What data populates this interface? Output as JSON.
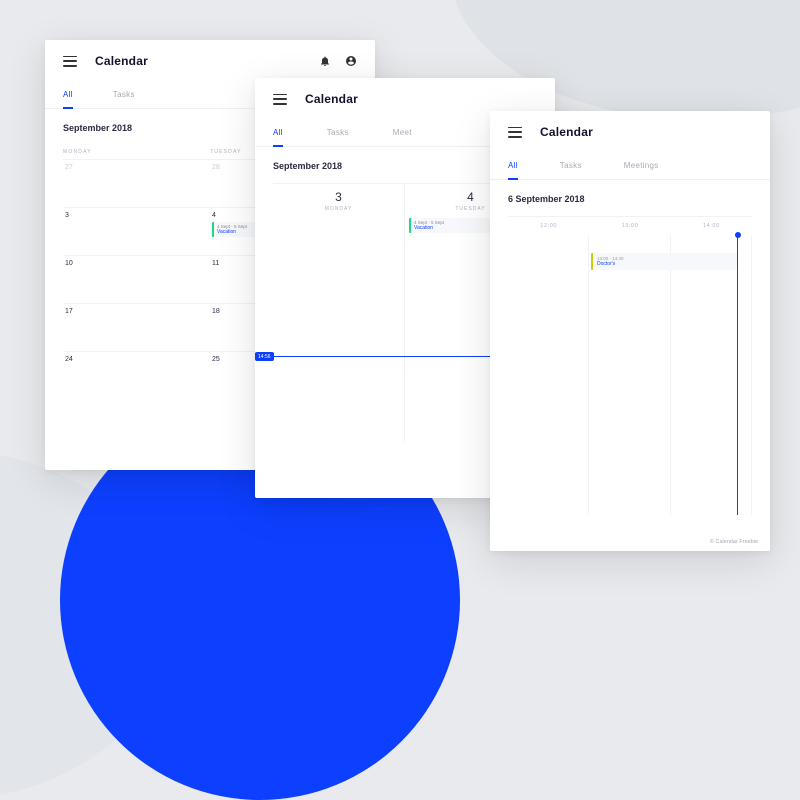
{
  "header": {
    "title": "Calendar"
  },
  "tabs": {
    "all": "All",
    "tasks": "Tasks",
    "meetings": "Meetings"
  },
  "month_view": {
    "subtitle": "September 2018",
    "day_labels": {
      "mon": "MONDAY",
      "tue": "TUESDAY"
    },
    "rows": [
      {
        "mon": "27",
        "tue": "28",
        "muted": true
      },
      {
        "mon": "3",
        "tue": "4"
      },
      {
        "mon": "10",
        "tue": "11"
      },
      {
        "mon": "17",
        "tue": "18"
      },
      {
        "mon": "24",
        "tue": "25"
      }
    ],
    "event": {
      "time": "4 Sept - 5 Sept",
      "name": "Vacation"
    }
  },
  "week_view": {
    "subtitle": "September 2018",
    "cols": [
      {
        "num": "3",
        "name": "MONDAY"
      },
      {
        "num": "4",
        "name": "TUESDAY"
      }
    ],
    "event": {
      "time": "4 Sept - 5 Sept",
      "name": "Vacation"
    },
    "now": "14:56"
  },
  "day_view": {
    "subtitle": "6 September 2018",
    "times": {
      "t1": "12:00",
      "t2": "13:00",
      "t3": "14:00"
    },
    "event": {
      "time": "13:00 - 14:40",
      "name": "Doctor's"
    }
  },
  "footer": "© Calendar Freebie"
}
